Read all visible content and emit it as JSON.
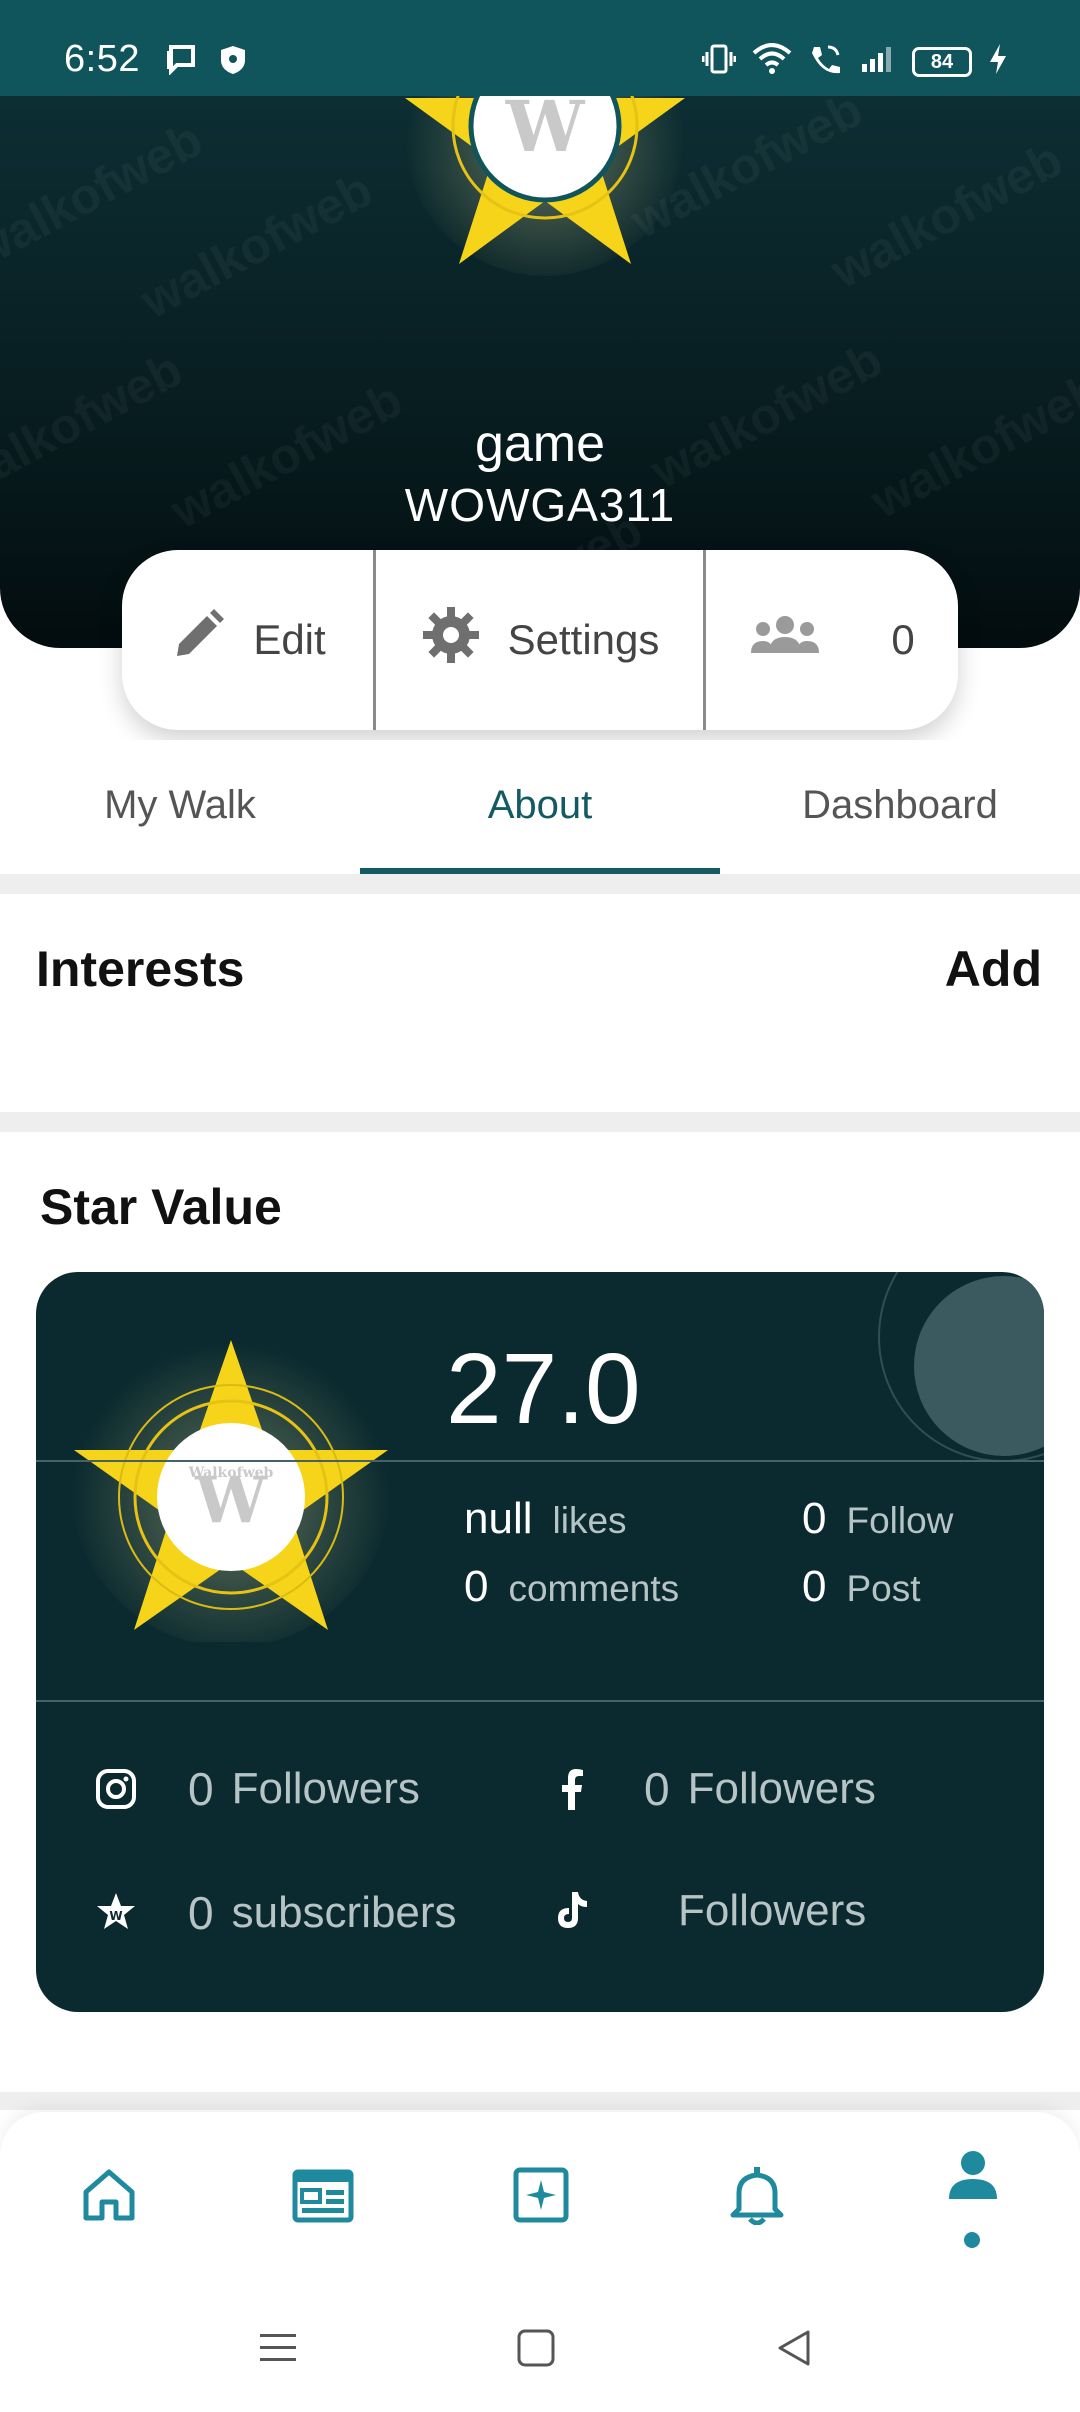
{
  "status_bar": {
    "time": "6:52",
    "battery": "84",
    "bg_color": "#10545c"
  },
  "profile": {
    "name": "game",
    "code": "WOWGA311",
    "watermark_text": "walkofweb"
  },
  "actions": {
    "edit_label": "Edit",
    "settings_label": "Settings",
    "friends_count": "0"
  },
  "tabs": [
    {
      "label": "My Walk",
      "active": false
    },
    {
      "label": "About",
      "active": true
    },
    {
      "label": "Dashboard",
      "active": false
    }
  ],
  "interests": {
    "title": "Interests",
    "add_label": "Add"
  },
  "star_value": {
    "title": "Star Value",
    "value": "27.0",
    "logo_text": "Walkofweb",
    "stats": {
      "likes_value": "null",
      "likes_label": "likes",
      "follow_value": "0",
      "follow_label": "Follow",
      "comments_value": "0",
      "comments_label": "comments",
      "post_value": "0",
      "post_label": "Post"
    },
    "socials": {
      "instagram_value": "0",
      "instagram_label": "Followers",
      "facebook_value": "0",
      "facebook_label": "Followers",
      "walkofweb_value": "0",
      "walkofweb_label": "subscribers",
      "tiktok_label": "Followers"
    }
  },
  "bottom_nav": {
    "items": [
      "home-icon",
      "feed-icon",
      "star-icon",
      "bell-icon",
      "profile-icon"
    ],
    "accent_color": "#1f8a9e"
  },
  "colors": {
    "accent": "#145a63",
    "card_bg": "#0b2a2f",
    "star_yellow": "#f5d419"
  }
}
